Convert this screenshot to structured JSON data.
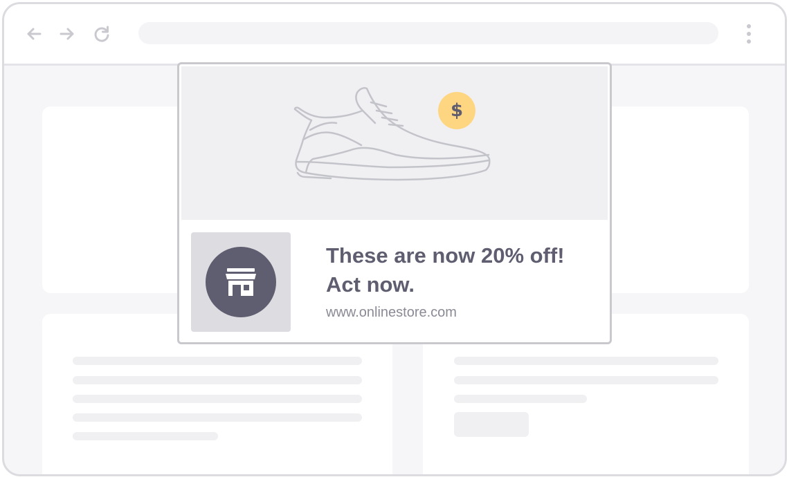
{
  "browser": {
    "back_icon": "arrow-left-icon",
    "forward_icon": "arrow-right-icon",
    "reload_icon": "reload-icon",
    "menu_icon": "kebab-menu-icon"
  },
  "notification": {
    "headline_line1": "These are now 20% off!",
    "headline_line2": "Act now.",
    "url": "www.onlinestore.com",
    "badge_symbol": "$",
    "product_icon": "sneaker-icon",
    "store_icon": "storefront-icon"
  },
  "colors": {
    "accent_text": "#5f5e70",
    "badge": "#fed681",
    "store_circle": "#5f5d70"
  }
}
